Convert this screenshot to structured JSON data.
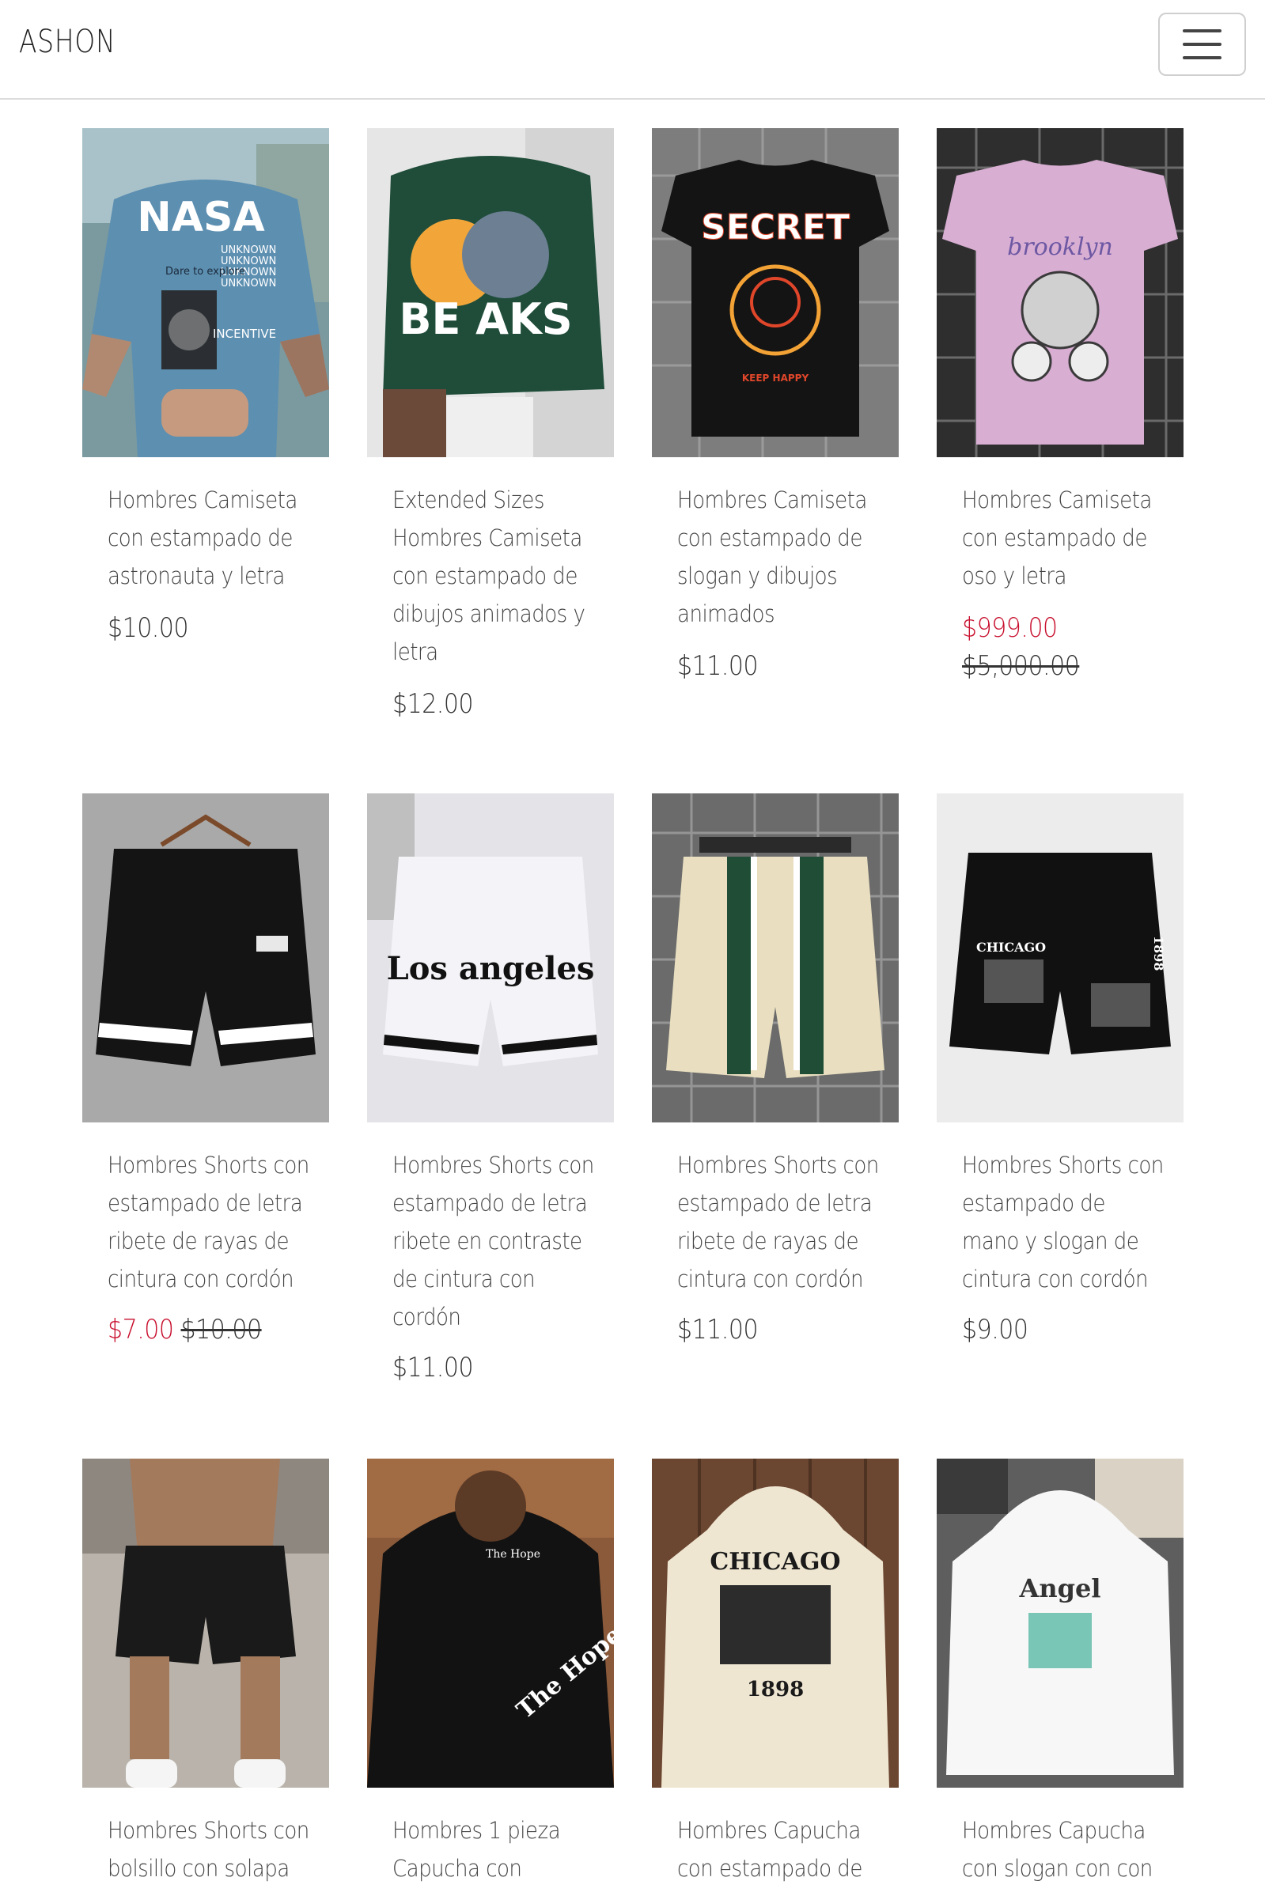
{
  "header": {
    "brand": "ASHON"
  },
  "products": [
    {
      "title_lines": [
        "Hombres Camiseta",
        "con estampado de",
        "astronauta y letra"
      ],
      "price": "$10.00",
      "sale_price": "",
      "old_price": ""
    },
    {
      "title_lines": [
        "Extended Sizes",
        "Hombres Camiseta",
        "con estampado de",
        "dibujos animados y",
        "letra"
      ],
      "price": "$12.00",
      "sale_price": "",
      "old_price": ""
    },
    {
      "title_lines": [
        "Hombres Camiseta",
        "con estampado de",
        "slogan y dibujos",
        "animados"
      ],
      "price": "$11.00",
      "sale_price": "",
      "old_price": ""
    },
    {
      "title_lines": [
        "Hombres Camiseta",
        "con estampado de",
        "oso y letra"
      ],
      "price": "",
      "sale_price": "$999.00",
      "old_price": "$5,000.00"
    },
    {
      "title_lines": [
        "Hombres Shorts con",
        "estampado de letra",
        "ribete de rayas de",
        "cintura con cordón"
      ],
      "price": "",
      "sale_price": "$7.00",
      "old_price": "$10.00"
    },
    {
      "title_lines": [
        "Hombres Shorts con",
        "estampado de letra",
        "ribete en contraste",
        "de cintura con",
        "cordón"
      ],
      "price": "$11.00",
      "sale_price": "",
      "old_price": ""
    },
    {
      "title_lines": [
        "Hombres Shorts con",
        "estampado de letra",
        "ribete de rayas de",
        "cintura con cordón"
      ],
      "price": "$11.00",
      "sale_price": "",
      "old_price": ""
    },
    {
      "title_lines": [
        "Hombres Shorts con",
        "estampado de",
        "mano y slogan de",
        "cintura con cordón"
      ],
      "price": "$9.00",
      "sale_price": "",
      "old_price": ""
    },
    {
      "title_lines": [
        "Hombres Shorts con",
        "bolsillo con solapa"
      ],
      "price": "",
      "sale_price": "",
      "old_price": ""
    },
    {
      "title_lines": [
        "Hombres 1 pieza",
        "Capucha con"
      ],
      "price": "",
      "sale_price": "",
      "old_price": ""
    },
    {
      "title_lines": [
        "Hombres Capucha",
        "con estampado de"
      ],
      "price": "",
      "sale_price": "",
      "old_price": ""
    },
    {
      "title_lines": [
        "Hombres Capucha",
        "con slogan con con"
      ],
      "price": "",
      "sale_price": "",
      "old_price": ""
    }
  ],
  "image_text": {
    "p1_brand": "NASA",
    "p1_lines": [
      "UNKNOWN",
      "UNKNOWN",
      "UNKNOWN",
      "UNKNOWN"
    ],
    "p1_sub": "Dare to explore",
    "p1_inc": "INCENTIVE",
    "p2_art": "BE AKS",
    "p3_art": "SECRET",
    "p3_sub": "KEEP HAPPY",
    "p4_art": "brooklyn",
    "p6_art": "Los angeles",
    "p8_art": "CHICAGO",
    "p8_year": "1898",
    "p10_art": "The Hope",
    "p11_art": "CHICAGO",
    "p11_year": "1898",
    "p12_art": "Angel"
  },
  "colors": {
    "sale": "#c8102e",
    "text": "#333333",
    "border": "#dcdcdc"
  }
}
